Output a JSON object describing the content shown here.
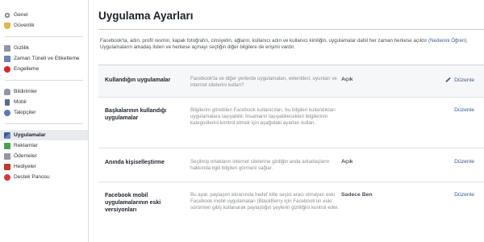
{
  "sidebar": {
    "groups": [
      [
        {
          "label": "Genel",
          "icon": "gear-icon"
        },
        {
          "label": "Güvenlik",
          "icon": "shield-icon"
        }
      ],
      [
        {
          "label": "Gizlilik",
          "icon": "lock-icon"
        },
        {
          "label": "Zaman Tüneli ve Etiketleme",
          "icon": "timeline-icon"
        },
        {
          "label": "Engelleme",
          "icon": "block-icon"
        }
      ],
      [
        {
          "label": "Bildirimler",
          "icon": "bell-icon"
        },
        {
          "label": "Mobil",
          "icon": "mobile-icon"
        },
        {
          "label": "Takipçiler",
          "icon": "followers-icon"
        }
      ],
      [
        {
          "label": "Uygulamalar",
          "icon": "apps-icon",
          "active": true
        },
        {
          "label": "Reklamlar",
          "icon": "ads-icon"
        },
        {
          "label": "Ödemeler",
          "icon": "payments-icon"
        },
        {
          "label": "Hediyeler",
          "icon": "gift-icon"
        },
        {
          "label": "Destek Panosu",
          "icon": "help-icon"
        }
      ]
    ]
  },
  "main": {
    "title": "Uygulama Ayarları",
    "intro_text": "Facebook'ta, adın, profil resmin, kapak fotoğrafın, cinsiyetin, ağların, kullanıcı adın ve kullanıcı kimliğin, uygulamalar dahil her zaman herkese açıktır",
    "intro_link": "(Nedenini Öğren)",
    "intro_text2": ". Uygulamaların arkadaş listen ve herkese açmayı seçtiğin diğer bilgilere de erişimi vardır.",
    "edit_label": "Düzenle",
    "rows": [
      {
        "title": "Kullandığın uygulamalar",
        "desc": "Facebook'ta ve diğer yerlerde uygulamaları, eklentileri, oyunları ve internet sitelerini kullan?",
        "status": "Açık"
      },
      {
        "title": "Başkalarının kullandığı uygulamalar",
        "desc": "Bilgilerini görebilen Facebook kullanıcıları, bu bilgileri kullandıkları uygulamalara taşıyabilir. İnsanların taşıyabilecekleri bilgilerinin kategorilerini kontrol etmek için aşağıdaki ayarları kullan.",
        "status": ""
      },
      {
        "title": "Anında kişiselleştirme",
        "desc": "Seçilmiş ortakların internet sitelerine girdiğin anda arkadaşların hakkında ilgili bilgileri görmeni sağlar.",
        "status": "Açık"
      },
      {
        "title": "Facebook mobil uygulamalarının eski versiyonları",
        "desc": "Bu ayar, paylaşım ekranında hedef kitle seçici aracı olmayan eski Facebook mobil uygulamaları (BlackBerry için Facebook'un eski sürümleri gibi) kullanarak paylaştığın şeylerin gizliliğini kontrol eder.",
        "status": "Sadece Ben"
      }
    ]
  },
  "colors": {
    "link": "#3b5998",
    "active_bg": "#e9ebee"
  }
}
